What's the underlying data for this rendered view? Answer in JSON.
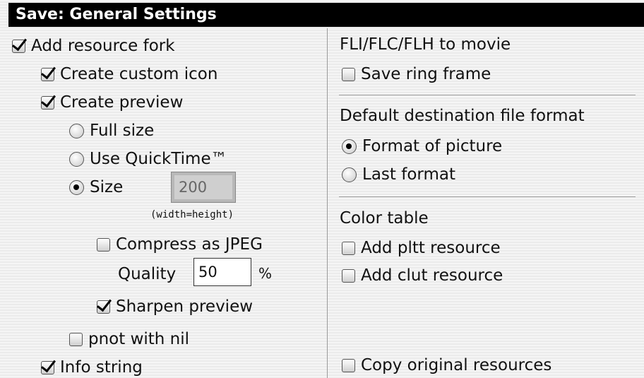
{
  "window": {
    "title": "Save: General Settings"
  },
  "left": {
    "add_resource_fork": {
      "label": "Add resource fork",
      "checked": true
    },
    "create_custom_icon": {
      "label": "Create custom icon",
      "checked": true
    },
    "create_preview": {
      "label": "Create preview",
      "checked": true
    },
    "preview_size_options": [
      {
        "label": "Full size",
        "selected": false
      },
      {
        "label": "Use QuickTime™",
        "selected": false
      },
      {
        "label": "Size",
        "selected": true
      }
    ],
    "size_field": {
      "value": "200",
      "note": "(width=height)"
    },
    "compress_jpeg": {
      "label": "Compress as JPEG",
      "checked": false
    },
    "quality": {
      "label": "Quality",
      "value": "50",
      "unit": "%"
    },
    "sharpen_preview": {
      "label": "Sharpen preview",
      "checked": true
    },
    "pnot_with_nil": {
      "label": "pnot with nil",
      "checked": false
    },
    "info_string": {
      "label": "Info string",
      "checked": true
    }
  },
  "right": {
    "fli_heading": "FLI/FLC/FLH to movie",
    "save_ring_frame": {
      "label": "Save ring frame",
      "checked": false
    },
    "dest_format_heading": "Default destination file format",
    "dest_format_options": [
      {
        "label": "Format of picture",
        "selected": true
      },
      {
        "label": "Last format",
        "selected": false
      }
    ],
    "color_table_heading": "Color table",
    "add_pltt": {
      "label": "Add pltt resource",
      "checked": false
    },
    "add_clut": {
      "label": "Add clut resource",
      "checked": false
    },
    "copy_original": {
      "label": "Copy original resources",
      "checked": false
    }
  }
}
